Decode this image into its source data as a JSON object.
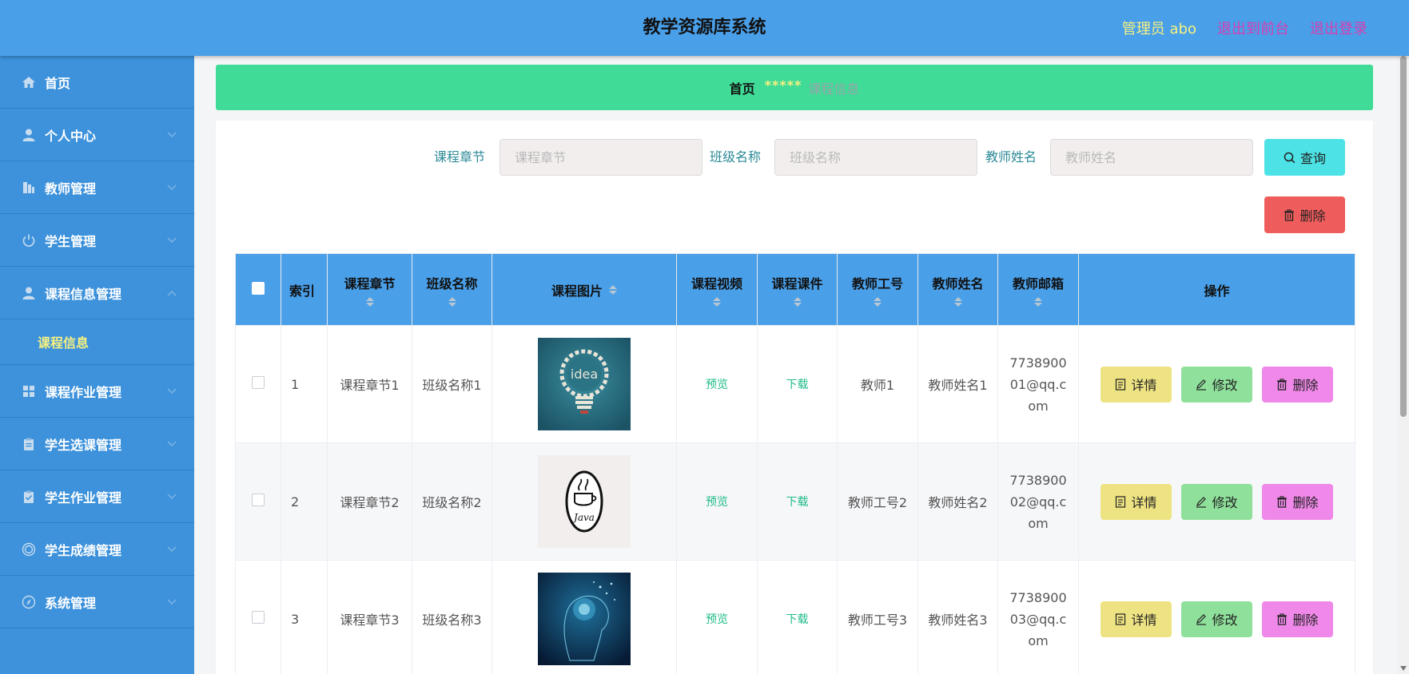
{
  "header": {
    "title": "教学资源库系统",
    "admin": "管理员 abo",
    "back_front": "退出到前台",
    "logout": "退出登录"
  },
  "sidebar": {
    "items": [
      {
        "label": "首页",
        "icon": "home-icon"
      },
      {
        "label": "个人中心",
        "icon": "user-icon"
      },
      {
        "label": "教师管理",
        "icon": "building-icon"
      },
      {
        "label": "学生管理",
        "icon": "power-icon"
      },
      {
        "label": "课程信息管理",
        "icon": "user-icon",
        "expanded": true,
        "sub": [
          "课程信息"
        ]
      },
      {
        "label": "课程作业管理",
        "icon": "grid-icon"
      },
      {
        "label": "学生选课管理",
        "icon": "clipboard-icon"
      },
      {
        "label": "学生作业管理",
        "icon": "clipboard-check-icon"
      },
      {
        "label": "学生成绩管理",
        "icon": "target-icon"
      },
      {
        "label": "系统管理",
        "icon": "compass-icon"
      }
    ]
  },
  "breadcrumb": {
    "home": "首页",
    "separator": "*****",
    "current": "课程信息"
  },
  "search": {
    "chapter_label": "课程章节",
    "chapter_placeholder": "课程章节",
    "class_label": "班级名称",
    "class_placeholder": "班级名称",
    "teacher_label": "教师姓名",
    "teacher_placeholder": "教师姓名",
    "search_button": "查询",
    "delete_button": "删除"
  },
  "table": {
    "columns": [
      "索引",
      "课程章节",
      "班级名称",
      "课程图片",
      "课程视频",
      "课程课件",
      "教师工号",
      "教师姓名",
      "教师邮箱",
      "操作"
    ],
    "rows": [
      {
        "index": "1",
        "chapter": "课程章节1",
        "class_name": "班级名称1",
        "image": "idea-bulb-image",
        "video": "预览",
        "courseware": "下载",
        "teacher_id": "教师1",
        "teacher_name": "教师姓名1",
        "email": "773890001@qq.com"
      },
      {
        "index": "2",
        "chapter": "课程章节2",
        "class_name": "班级名称2",
        "image": "java-logo-image",
        "video": "预览",
        "courseware": "下载",
        "teacher_id": "教师工号2",
        "teacher_name": "教师姓名2",
        "email": "773890002@qq.com"
      },
      {
        "index": "3",
        "chapter": "课程章节3",
        "class_name": "班级名称3",
        "image": "ai-head-image",
        "video": "预览",
        "courseware": "下载",
        "teacher_id": "教师工号3",
        "teacher_name": "教师姓名3",
        "email": "773890003@qq.com"
      }
    ],
    "actions": {
      "detail": "详情",
      "edit": "修改",
      "delete": "删除"
    }
  },
  "colors": {
    "header": "#499fe8",
    "sidebar": "#3d92db",
    "breadcrumb": "#3fdb97",
    "accent_yellow": "#f6f181",
    "search_button": "#4de3e6",
    "delete_button": "#ef5c5c"
  }
}
